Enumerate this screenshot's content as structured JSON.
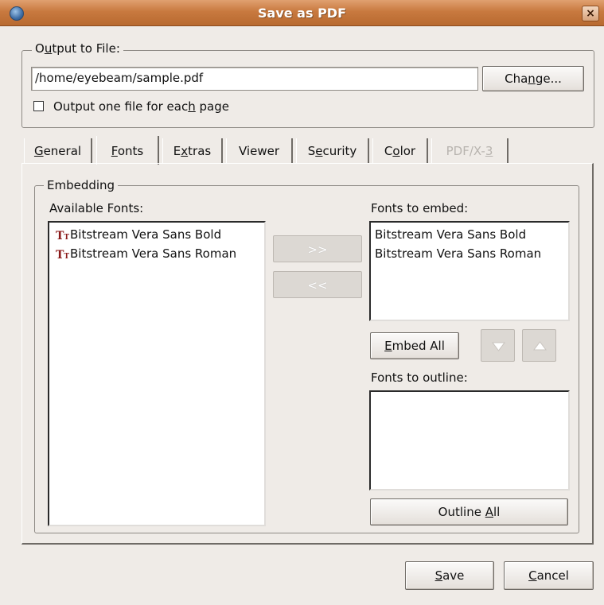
{
  "window": {
    "title": "Save as PDF",
    "close_label": "×"
  },
  "output": {
    "frame_label": "Output to File:",
    "file_path": "/home/eyebeam/sample.pdf",
    "change_button": "Change...",
    "one_file_label": "Output one file for each page",
    "one_file_checked": false
  },
  "tabs": [
    {
      "label": "General",
      "active": false,
      "enabled": true
    },
    {
      "label": "Fonts",
      "active": true,
      "enabled": true
    },
    {
      "label": "Extras",
      "active": false,
      "enabled": true
    },
    {
      "label": "Viewer",
      "active": false,
      "enabled": true
    },
    {
      "label": "Security",
      "active": false,
      "enabled": true
    },
    {
      "label": "Color",
      "active": false,
      "enabled": true
    },
    {
      "label": "PDF/X-3",
      "active": false,
      "enabled": false
    }
  ],
  "embedding": {
    "frame_label": "Embedding",
    "available_label": "Available Fonts:",
    "available_fonts": [
      "Bitstream Vera Sans Bold",
      "Bitstream Vera Sans Roman"
    ],
    "add_button": ">>",
    "remove_button": "<<",
    "embed_label": "Fonts to embed:",
    "embed_fonts": [
      "Bitstream Vera Sans Bold",
      "Bitstream Vera Sans Roman"
    ],
    "embed_all_button": "Embed All",
    "outline_label": "Fonts to outline:",
    "outline_fonts": [],
    "outline_all_button": "Outline All"
  },
  "footer": {
    "save_button": "Save",
    "cancel_button": "Cancel"
  },
  "colors": {
    "titlebar": "#c8793f",
    "font_icon": "#8b1a1a",
    "background": "#efebe7"
  },
  "icons": {
    "font_item": "truetype-font-icon",
    "move_down": "arrow-down-icon",
    "move_up": "arrow-up-icon"
  }
}
